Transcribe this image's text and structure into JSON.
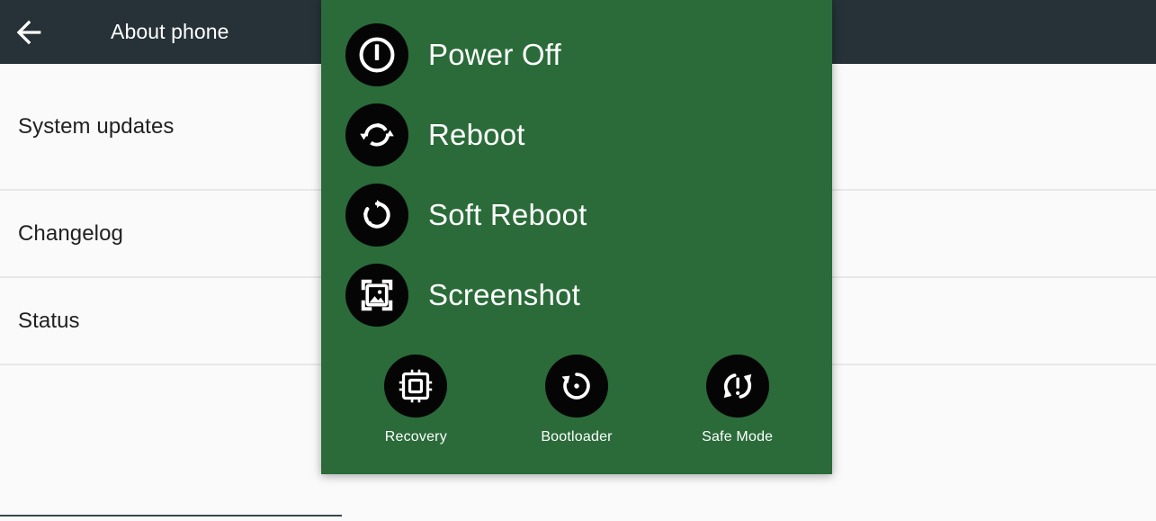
{
  "appbar": {
    "back_icon": "arrow-back-icon",
    "title": "About phone"
  },
  "settings_list": {
    "items": [
      {
        "label": "System updates"
      },
      {
        "label": "Changelog"
      },
      {
        "label": "Status"
      }
    ]
  },
  "power_dialog": {
    "background_color": "#2a6b39",
    "icon_background_color": "#050505",
    "text_color": "#ffffff",
    "actions": [
      {
        "label": "Power Off",
        "icon": "power-off-icon"
      },
      {
        "label": "Reboot",
        "icon": "reboot-icon"
      },
      {
        "label": "Soft Reboot",
        "icon": "soft-reboot-icon"
      },
      {
        "label": "Screenshot",
        "icon": "screenshot-icon"
      }
    ],
    "advanced": [
      {
        "label": "Recovery",
        "icon": "cpu-chip-icon"
      },
      {
        "label": "Bootloader",
        "icon": "restore-icon"
      },
      {
        "label": "Safe Mode",
        "icon": "safe-mode-icon"
      }
    ]
  }
}
